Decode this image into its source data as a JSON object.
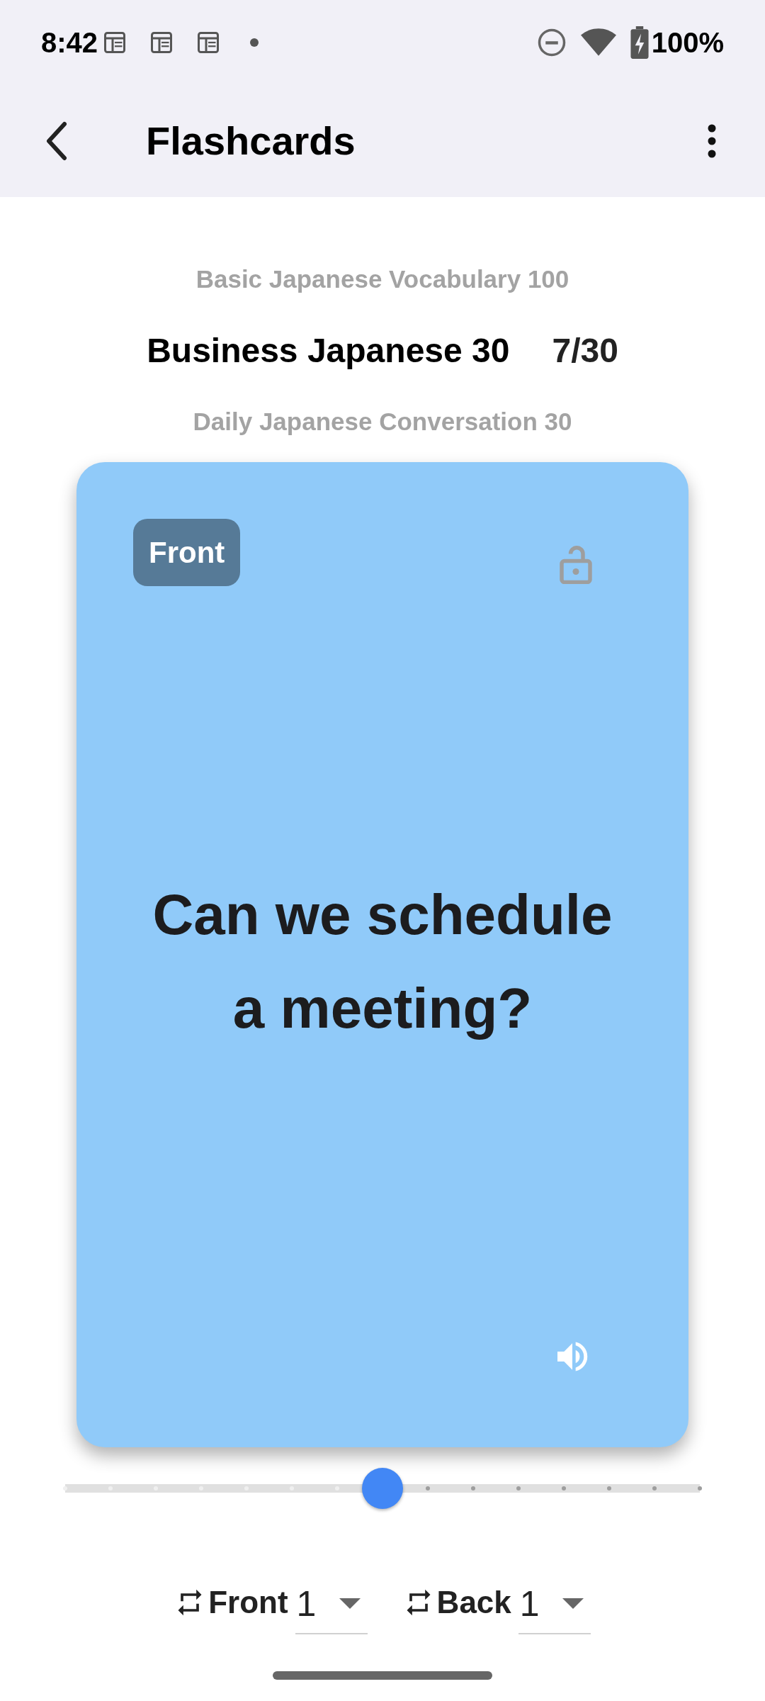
{
  "status_bar": {
    "time": "8:42",
    "battery": "100%"
  },
  "app_bar": {
    "title": "Flashcards"
  },
  "decks": [
    {
      "name": "Basic Japanese Vocabulary 100",
      "selected": false
    },
    {
      "name": "Business Japanese 30",
      "selected": true,
      "progress": "7/30"
    },
    {
      "name": "Daily Japanese Conversation 30",
      "selected": false
    }
  ],
  "card": {
    "side_label": "Front",
    "locked": false,
    "text": "Can we schedule a meeting?"
  },
  "slider": {
    "level": 0.5
  },
  "selectors": [
    {
      "label": "Front",
      "value": "1"
    },
    {
      "label": "Back",
      "value": "1"
    }
  ]
}
